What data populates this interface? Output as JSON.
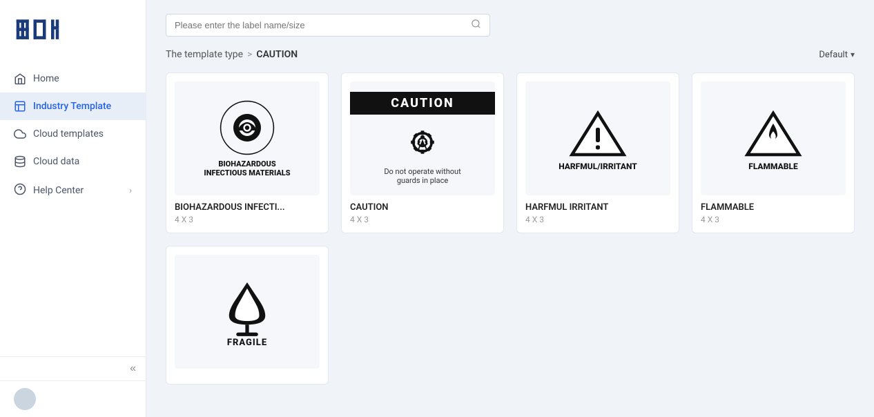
{
  "sidebar": {
    "logo_alt": "Logo",
    "nav_items": [
      {
        "id": "home",
        "label": "Home",
        "icon": "home-icon",
        "active": false
      },
      {
        "id": "industry-template",
        "label": "Industry Template",
        "icon": "template-icon",
        "active": true
      },
      {
        "id": "cloud-templates",
        "label": "Cloud templates",
        "icon": "cloud-icon",
        "active": false
      },
      {
        "id": "cloud-data",
        "label": "Cloud data",
        "icon": "cloud-data-icon",
        "active": false
      }
    ],
    "help_label": "Help Center",
    "collapse_symbol": "«"
  },
  "search": {
    "placeholder": "Please enter the label name/size"
  },
  "breadcrumb": {
    "base": "The template type",
    "separator": ">",
    "current": "CAUTION"
  },
  "sort": {
    "label": "Default"
  },
  "templates": [
    {
      "id": "biohazard",
      "title": "BIOHAZARDOUS INFECTI...",
      "size": "4 X 3",
      "icon": "biohazard-icon"
    },
    {
      "id": "caution",
      "title": "CAUTION",
      "size": "4 X 3",
      "icon": "caution-icon"
    },
    {
      "id": "harfmul",
      "title": "HARFMUL IRRITANT",
      "size": "4 X 3",
      "icon": "warning-irritant-icon"
    },
    {
      "id": "flammable",
      "title": "FLAMMABLE",
      "size": "4 X 3",
      "icon": "flammable-icon"
    }
  ],
  "templates_row2": [
    {
      "id": "fragile",
      "title": "FRAGILE",
      "size": "4 X 3",
      "icon": "fragile-icon"
    }
  ]
}
